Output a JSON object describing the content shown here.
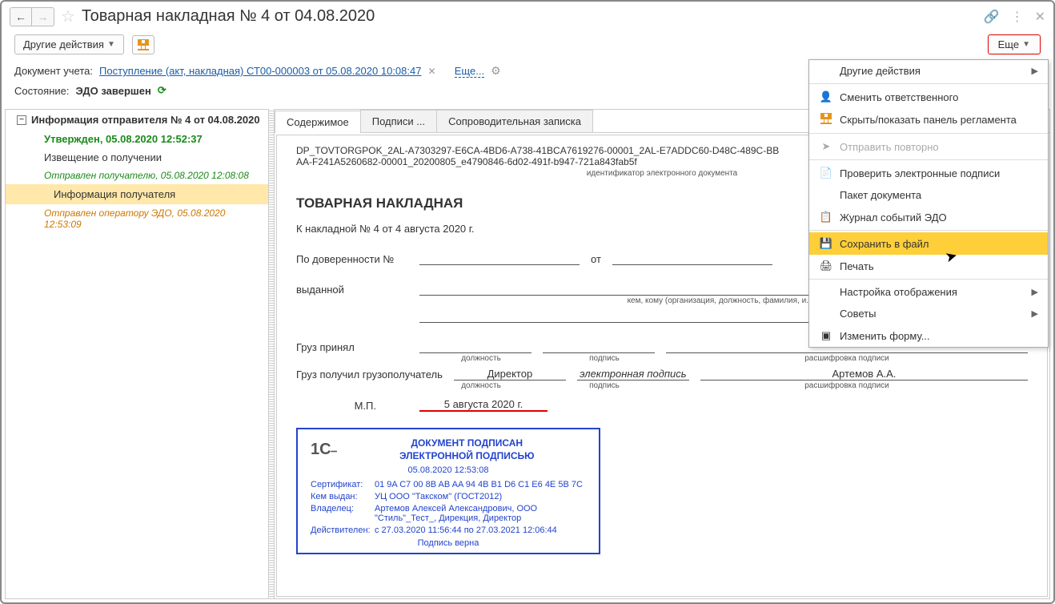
{
  "title": "Товарная накладная № 4 от 04.08.2020",
  "toolbar": {
    "other_actions": "Другие действия",
    "more": "Еще"
  },
  "info": {
    "doc_label": "Документ учета:",
    "doc_link": "Поступление (акт, накладная) СТ00-000003 от 05.08.2020 10:08:47",
    "more_link": "Еще...",
    "state_label": "Состояние:",
    "state_value": "ЭДО завершен"
  },
  "tree": {
    "header": "Информация отправителя № 4 от 04.08.2020",
    "approved": "Утвержден, 05.08.2020 12:52:37",
    "receipt_notice": "Извещение о получении",
    "receipt_status": "Отправлен получателю, 05.08.2020 12:08:08",
    "recipient_info": "Информация получателя",
    "recipient_status": "Отправлен оператору ЭДО, 05.08.2020 12:53:09"
  },
  "tabs": {
    "content": "Содержимое",
    "signatures": "Подписи ...",
    "cover_note": "Сопроводительная записка"
  },
  "doc": {
    "id_line1": "DP_TOVTORGPOK_2AL-A7303297-E6CA-4BD6-A738-41BCA7619276-00001_2AL-E7ADDC60-D48C-489C-BB",
    "id_line2": "AA-F241A5260682-00001_20200805_e4790846-6d02-491f-b947-721a843fab5f",
    "id_caption": "идентификатор электронного документа",
    "title": "ТОВАРНАЯ НАКЛАДНАЯ",
    "subtitle": "К накладной № 4 от 4 августа 2020 г.",
    "proxy_label": "По доверенности №",
    "from_label": "от",
    "issued_label": "выданной",
    "issued_caption": "кем, кому (организация, должность, фамилия, и. о.)",
    "cargo_accepted": "Груз принял",
    "cargo_received": "Груз получил грузополучатель",
    "position_cap": "должность",
    "signature_cap": "подпись",
    "decipher_cap": "расшифровка подписи",
    "director": "Директор",
    "esign": "электронная подпись",
    "name": "Артемов А.А.",
    "mp": "М.П.",
    "date_bottom": "5 августа 2020 г."
  },
  "signature_box": {
    "title1": "ДОКУМЕНТ ПОДПИСАН",
    "title2": "ЭЛЕКТРОННОЙ ПОДПИСЬЮ",
    "date": "05.08.2020 12:53:08",
    "cert_label": "Сертификат:",
    "cert_value": "01 9A C7 00 8B AB AA 94 4B B1 D6 C1 E6 4E 5B 7C",
    "issued_by_label": "Кем выдан:",
    "issued_by_value": "УЦ ООО \"Такском\" (ГОСТ2012)",
    "owner_label": "Владелец:",
    "owner_value": "Артемов Алексей Александрович, ООО \"Стиль\"_Тест_, Дирекция, Директор",
    "valid_label": "Действителен:",
    "valid_value": "с 27.03.2020 11:56:44 по 27.03.2021 12:06:44",
    "valid_text": "Подпись верна"
  },
  "menu": {
    "other_actions": "Другие действия",
    "change_responsible": "Сменить ответственного",
    "hide_show_panel": "Скрыть/показать панель регламента",
    "resend": "Отправить повторно",
    "verify_signatures": "Проверить электронные подписи",
    "doc_package": "Пакет документа",
    "event_log": "Журнал событий ЭДО",
    "save_to_file": "Сохранить в файл",
    "print": "Печать",
    "display_settings": "Настройка отображения",
    "tips": "Советы",
    "edit_form": "Изменить форму..."
  }
}
